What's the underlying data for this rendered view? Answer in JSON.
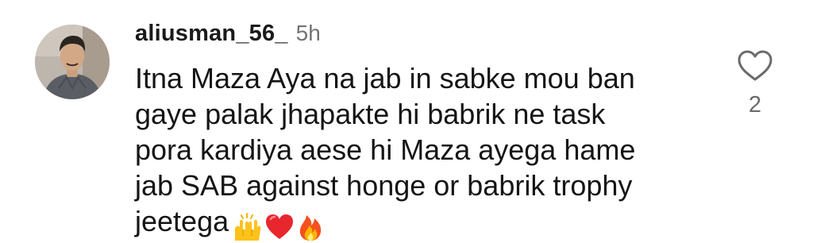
{
  "comment": {
    "username": "aliusman_56_",
    "timestamp": "5h",
    "text_lines": [
      "Itna Maza Aya na jab in sabke mou ban",
      "gaye palak jhapakte hi babrik ne task",
      "pora kardiya aese hi Maza ayega hame",
      "jab SAB against honge or babrik trophy",
      "jeetega"
    ],
    "emojis": [
      "raising-hands-emoji",
      "red-heart-emoji",
      "fire-emoji"
    ],
    "like_icon": "heart-outline-icon",
    "like_count": "2"
  },
  "colors": {
    "text": "#151515",
    "muted": "#737373",
    "icon": "#6b6b6b"
  }
}
